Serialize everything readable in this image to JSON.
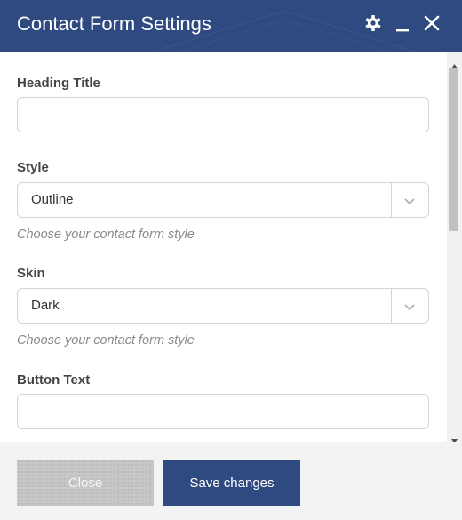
{
  "dialog": {
    "title": "Contact Form Settings"
  },
  "header_icons": [
    "gear-icon",
    "minimize-icon",
    "close-icon"
  ],
  "fields": {
    "heading_title": {
      "label": "Heading Title",
      "value": ""
    },
    "style": {
      "label": "Style",
      "value": "Outline",
      "hint": "Choose your contact form style"
    },
    "skin": {
      "label": "Skin",
      "value": "Dark",
      "hint": "Choose your contact form style"
    },
    "button_text": {
      "label": "Button Text",
      "value": ""
    }
  },
  "footer": {
    "close_label": "Close",
    "save_label": "Save changes"
  },
  "colors": {
    "header_bg": "#2f4a80",
    "primary_button": "#2f4a80",
    "disabled_button": "#c7c7c7",
    "hint_text": "#8a8a8a"
  }
}
